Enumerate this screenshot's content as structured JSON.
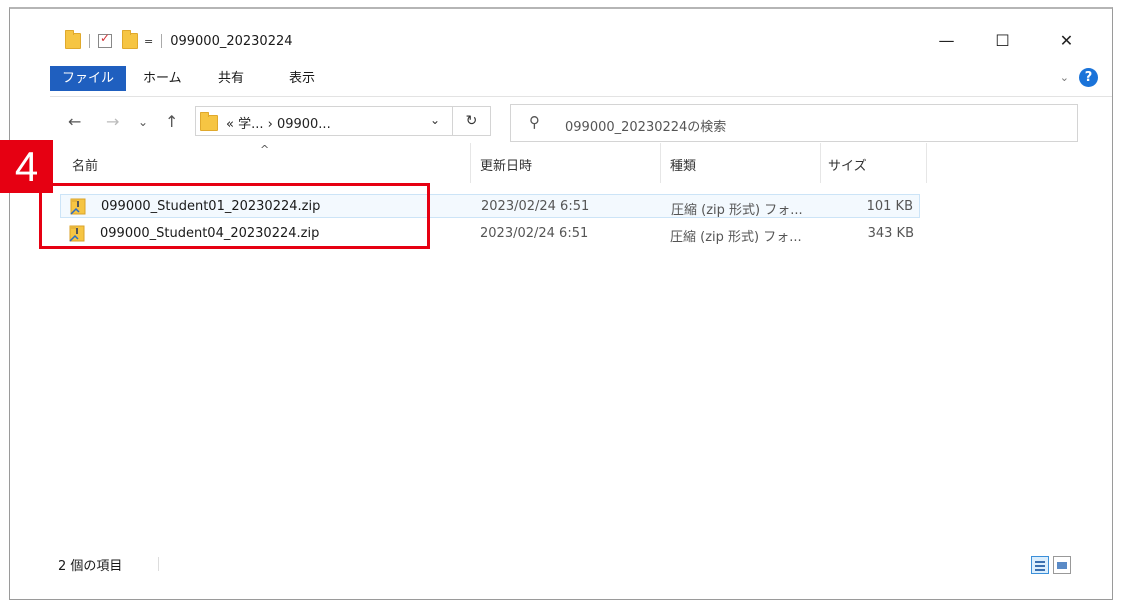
{
  "window": {
    "title": "099000_20230224"
  },
  "titlebar": {
    "minimize": "—",
    "maximize": "☐",
    "close": "✕",
    "dropdown": "="
  },
  "ribbon": {
    "tabs": [
      {
        "label": "ファイル",
        "active": true
      },
      {
        "label": "ホーム",
        "active": false
      },
      {
        "label": "共有",
        "active": false
      },
      {
        "label": "表示",
        "active": false
      }
    ],
    "expand": "⌄",
    "help": "?"
  },
  "nav": {
    "back": "←",
    "forward": "→",
    "recent": "⌄",
    "up": "↑",
    "address": "«  学...  ›  09900...",
    "address_dropdown": "⌄",
    "refresh": "↻",
    "search_placeholder": "099000_20230224の検索"
  },
  "columns": {
    "name": "名前",
    "date": "更新日時",
    "type": "種類",
    "size": "サイズ",
    "sort_indicator": "^"
  },
  "files": [
    {
      "name": "099000_Student01_20230224.zip",
      "date": "2023/02/24 6:51",
      "type": "圧縮 (zip 形式) フォ...",
      "size": "101 KB"
    },
    {
      "name": "099000_Student04_20230224.zip",
      "date": "2023/02/24 6:51",
      "type": "圧縮 (zip 形式) フォ...",
      "size": "343 KB"
    }
  ],
  "status": {
    "count": "2 個の項目"
  },
  "annotation": {
    "step": "4",
    "color": "#e60012"
  },
  "colors": {
    "accent": "#1f5fbf",
    "selection": "#cce4f7"
  }
}
